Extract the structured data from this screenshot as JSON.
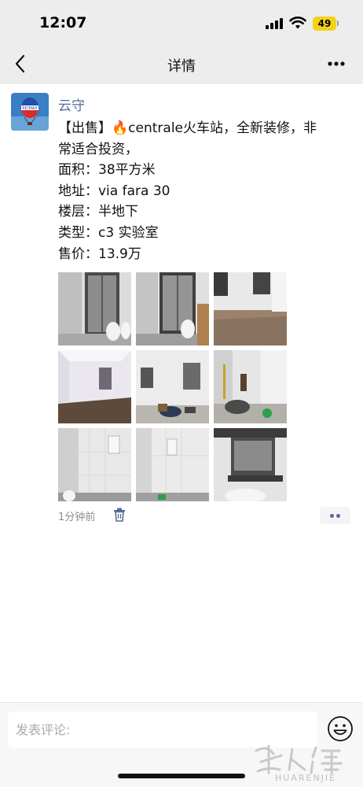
{
  "status_bar": {
    "time": "12:07",
    "battery": "49"
  },
  "nav": {
    "title": "详情"
  },
  "post": {
    "author": "云守",
    "lines": [
      "【出售】🔥centrale火车站，全新装修，非",
      "常适合投资，",
      "面积：38平方米",
      "地址：via fara 30",
      "楼层：半地下",
      "类型：c3 实验室",
      "售价：13.9万"
    ],
    "photos": [
      "bathroom-shower",
      "bathroom-shower-2",
      "room-wood-floor",
      "empty-room",
      "room-with-boxes",
      "room-renovation",
      "tiled-bathroom-boiler",
      "tiled-bathroom-2",
      "sink-mirror"
    ],
    "time": "1分钟前"
  },
  "comment": {
    "placeholder": "发表评论:"
  },
  "watermark": {
    "text": "HUARENJIE"
  },
  "colors": {
    "link_blue": "#576b95",
    "battery_yellow": "#f3d31a",
    "header_bg": "#ededed"
  },
  "icons": [
    "back-arrow-icon",
    "more-icon",
    "trash-icon",
    "emoji-icon"
  ]
}
